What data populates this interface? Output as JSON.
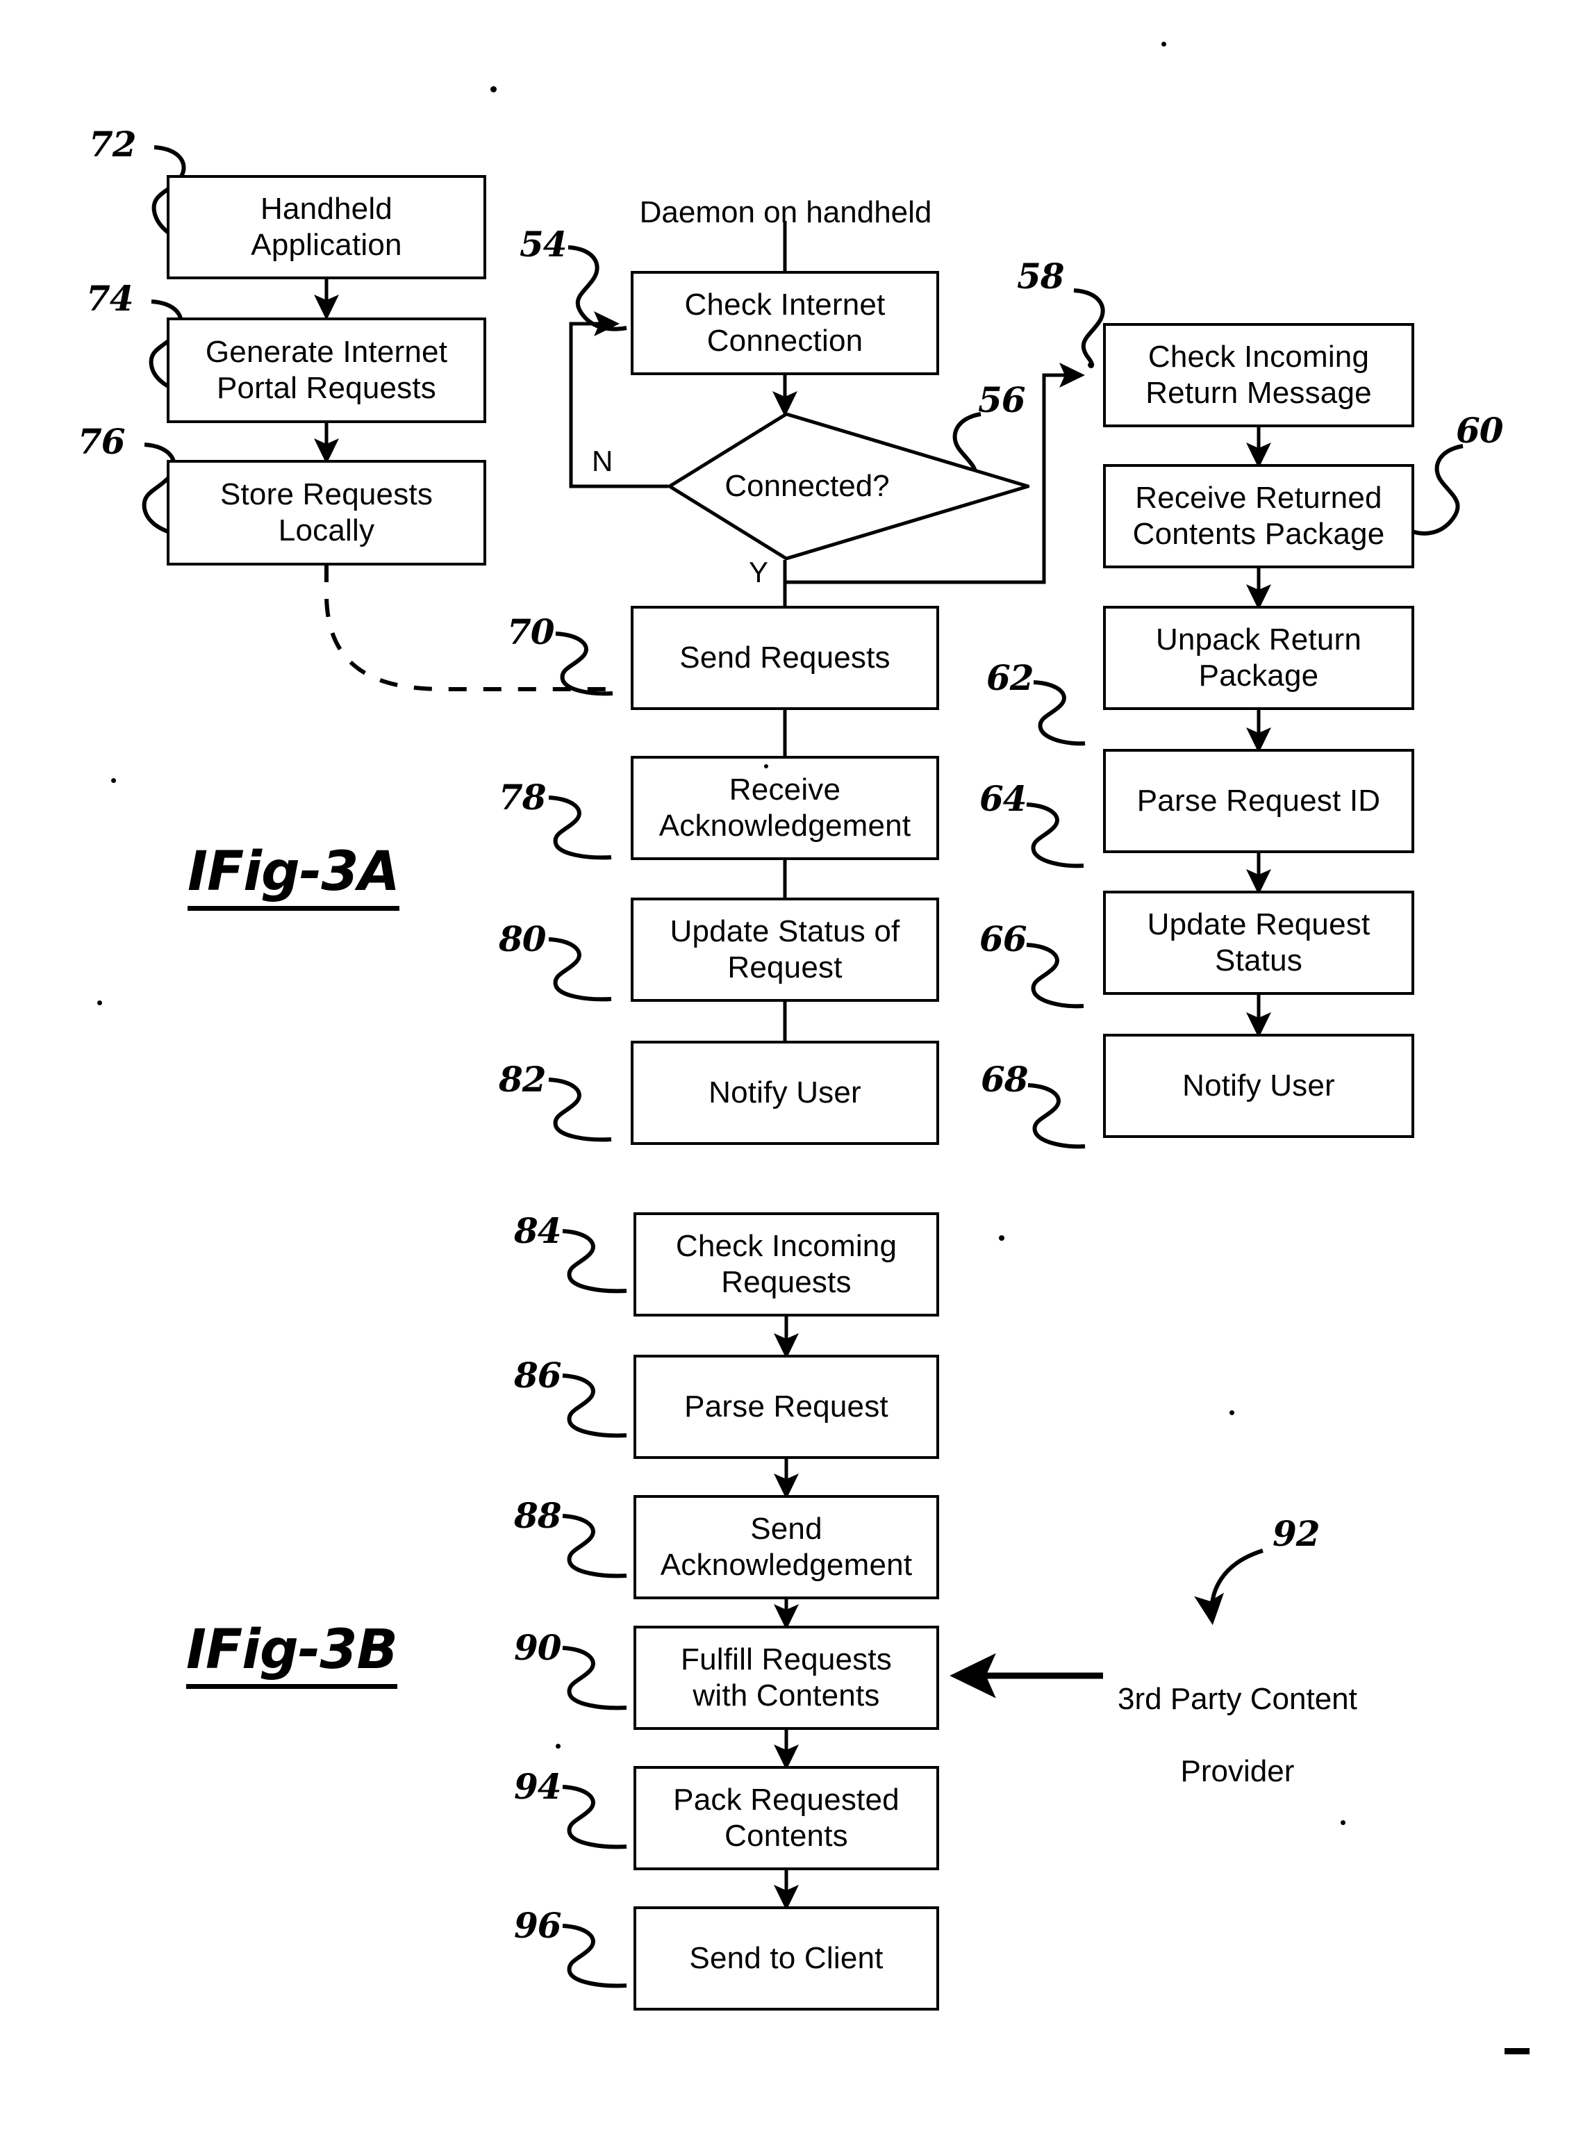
{
  "figure": {
    "type": "patent-flowchart",
    "captions": [
      {
        "id": "fig-3a",
        "text": "IFig-3A"
      },
      {
        "id": "fig-3b",
        "text": "IFig-3B"
      }
    ]
  },
  "annotations": {
    "daemon_label": "Daemon on handheld",
    "third_party_label_line1": "3rd Party Content",
    "third_party_label_line2": "Provider",
    "branch_no": "N",
    "branch_yes": "Y"
  },
  "fig3a": {
    "left_column": [
      {
        "ref": "72",
        "line1": "Handheld",
        "line2": "Application"
      },
      {
        "ref": "74",
        "line1": "Generate Internet",
        "line2": "Portal Requests"
      },
      {
        "ref": "76",
        "line1": "Store Requests",
        "line2": "Locally"
      }
    ],
    "middle_column": [
      {
        "ref": "54",
        "line1": "Check Internet",
        "line2": "Connection"
      },
      {
        "ref": "56",
        "line1": "Connected?",
        "line2": "",
        "shape": "diamond"
      },
      {
        "ref": "70",
        "line1": "Send Requests",
        "line2": ""
      },
      {
        "ref": "78",
        "line1": "Receive",
        "line2": "Acknowledgement"
      },
      {
        "ref": "80",
        "line1": "Update Status of",
        "line2": "Request"
      },
      {
        "ref": "82",
        "line1": "Notify User",
        "line2": ""
      }
    ],
    "right_column": [
      {
        "ref": "58",
        "line1": "Check Incoming",
        "line2": "Return Message"
      },
      {
        "ref": "60",
        "line1": "Receive Returned",
        "line2": "Contents Package"
      },
      {
        "ref": "62",
        "line1": "Unpack Return",
        "line2": "Package"
      },
      {
        "ref": "64",
        "line1": "Parse Request ID",
        "line2": ""
      },
      {
        "ref": "66",
        "line1": "Update Request",
        "line2": "Status"
      },
      {
        "ref": "68",
        "line1": "Notify User",
        "line2": ""
      }
    ]
  },
  "fig3b": {
    "column": [
      {
        "ref": "84",
        "line1": "Check Incoming",
        "line2": "Requests"
      },
      {
        "ref": "86",
        "line1": "Parse Request",
        "line2": ""
      },
      {
        "ref": "88",
        "line1": "Send",
        "line2": "Acknowledgement"
      },
      {
        "ref": "90",
        "line1": "Fulfill Requests",
        "line2": "with Contents"
      },
      {
        "ref": "94",
        "line1": "Pack Requested",
        "line2": "Contents"
      },
      {
        "ref": "96",
        "line1": "Send to Client",
        "line2": ""
      }
    ],
    "external": {
      "ref": "92",
      "line1": "3rd Party Content",
      "line2": "Provider"
    }
  },
  "colors": {
    "ink": "#000000",
    "paper": "#ffffff"
  }
}
